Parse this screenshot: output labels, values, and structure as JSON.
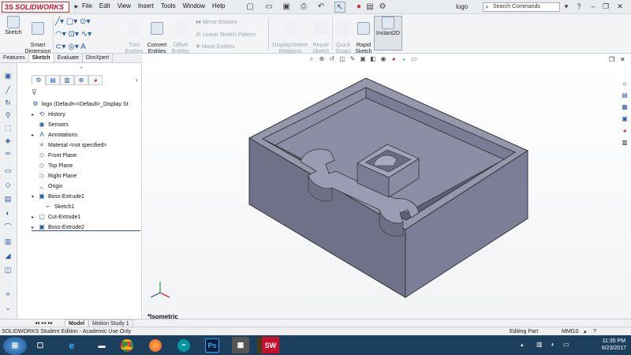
{
  "app": {
    "brand": "SOLIDWORKS",
    "doc_title": "logo"
  },
  "menu": [
    "File",
    "Edit",
    "View",
    "Insert",
    "Tools",
    "Window",
    "Help"
  ],
  "search": {
    "placeholder": "Search Commands"
  },
  "ribbon": {
    "sketch": "Sketch",
    "smart_dimension": "Smart\nDimension",
    "trim": "Trim\nEntities",
    "convert": "Convert\nEntities",
    "offset": "Offset\nEntities",
    "mirror": "Mirror Entities",
    "linear_pattern": "Linear Sketch Pattern",
    "move": "Move Entities",
    "display_delete": "Display/Delete\nRelations",
    "repair": "Repair\nSketch",
    "quick_snaps": "Quick\nSnaps",
    "rapid_sketch": "Rapid\nSketch",
    "instant2d": "Instant2D"
  },
  "tabs": [
    "Features",
    "Sketch",
    "Evaluate",
    "DimXpert"
  ],
  "tree": {
    "root": "logo  (Default<<Default>_Display St",
    "items": [
      "History",
      "Sensors",
      "Annotations",
      "Material <not specified>",
      "Front Plane",
      "Top Plane",
      "Right Plane",
      "Origin",
      "Boss-Extrude1",
      "Sketch1",
      "Cut-Extrude1",
      "Boss-Extrude2"
    ]
  },
  "viewport": {
    "view_label": "*Isometric"
  },
  "bottom_tabs": [
    "Model",
    "Motion Study 1"
  ],
  "status": {
    "edition": "SOLIDWORKS Student Edition - Academic Use Only",
    "mode": "Editing Part",
    "units": "MMGS"
  },
  "taskbar": {
    "time": "11:35 PM",
    "date": "6/23/2017"
  },
  "colors": {
    "model_face": "#7c7e98",
    "model_dark": "#55576c",
    "model_top": "#9496ad",
    "brand": "#c8102e",
    "taskbar": "#1c3f5e"
  }
}
